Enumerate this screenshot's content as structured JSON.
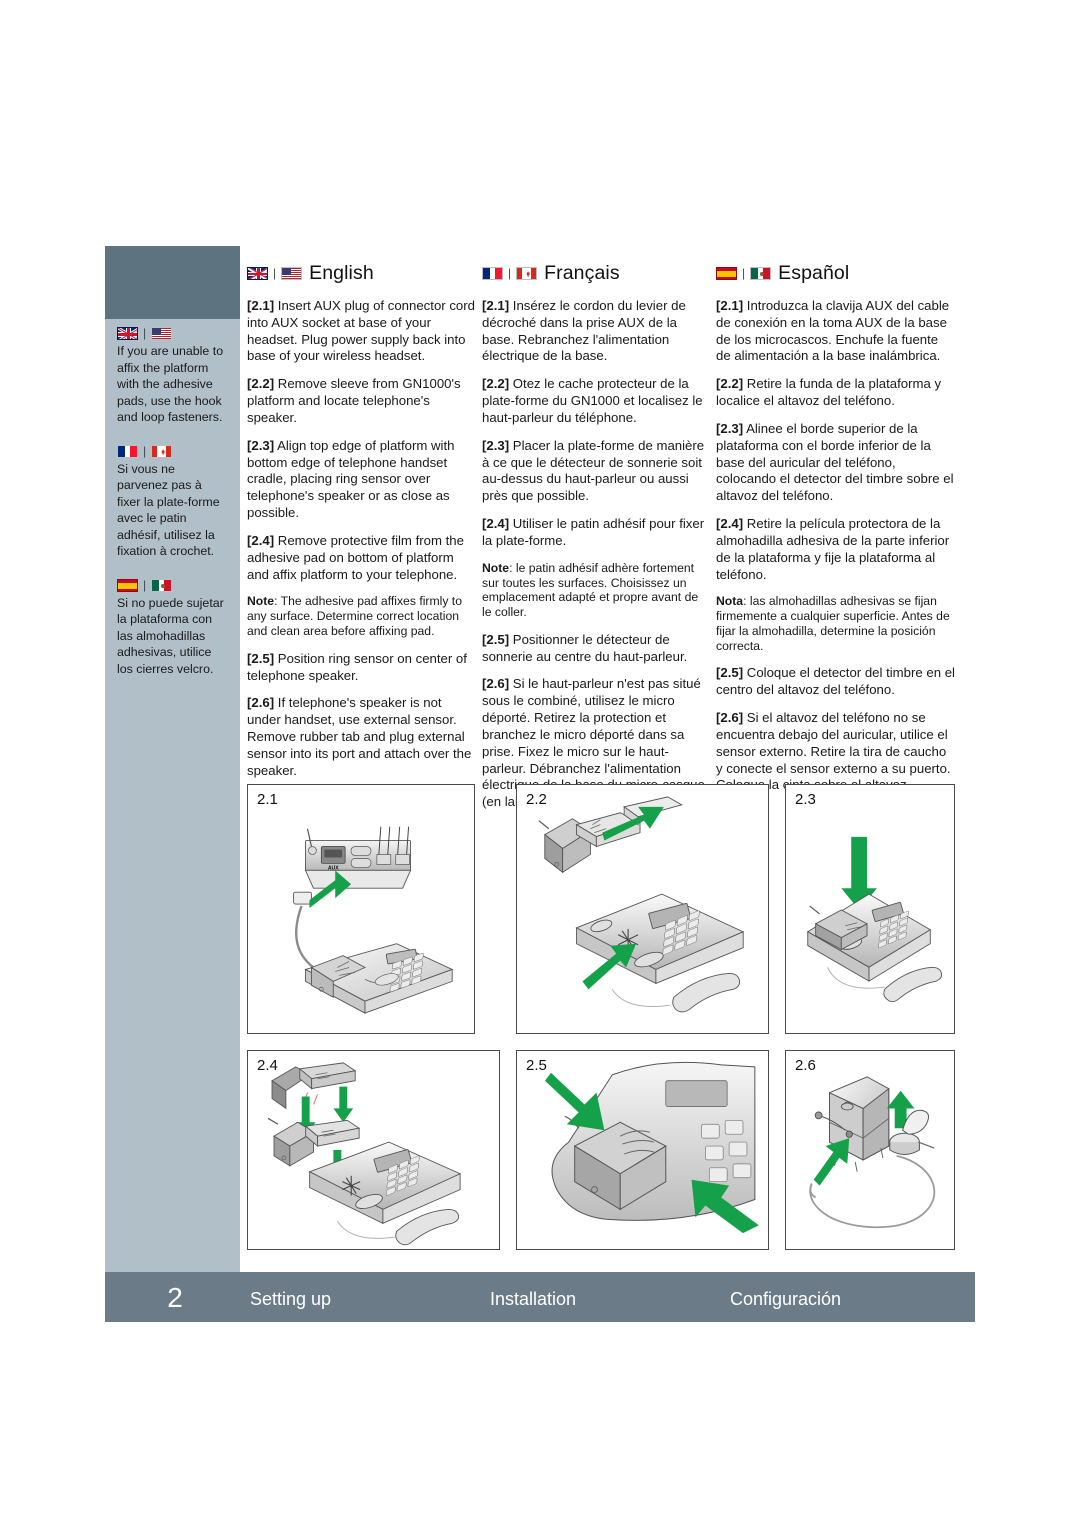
{
  "page": {
    "number": "2",
    "background": "#ffffff"
  },
  "colors": {
    "sidebar_header": "#5d7480",
    "sidebar_body": "#b0bfc8",
    "footer_bar": "#6b7c88",
    "arrow_green": "#15a04a",
    "text": "#1a1a1a"
  },
  "sidebar": {
    "notes": [
      {
        "flags": [
          "uk-flag",
          "us-flag"
        ],
        "text": "If you are unable to affix the platform with the adhesive pads, use the hook and loop fasteners."
      },
      {
        "flags": [
          "france-flag",
          "canada-flag"
        ],
        "text": "Si vous ne parvenez pas à fixer la plate-forme avec le patin adhésif, utilisez la fixation à crochet."
      },
      {
        "flags": [
          "spain-flag",
          "mexico-flag"
        ],
        "text": "Si no puede sujetar la plataforma con las almohadillas adhesivas, utilice los cierres velcro."
      }
    ]
  },
  "columns": {
    "english": {
      "language": "English",
      "flags": [
        "uk-flag",
        "us-flag"
      ],
      "steps": [
        {
          "num": "[2.1]",
          "text": "Insert AUX plug of connector cord into AUX socket at base of your headset. Plug power supply back into base of your wireless headset."
        },
        {
          "num": "[2.2]",
          "text": "Remove sleeve from GN1000's platform and locate telephone's speaker."
        },
        {
          "num": "[2.3]",
          "text": "Align top edge of platform with bottom edge of telephone handset cradle, placing ring sensor over telephone's speaker or as close as possible."
        },
        {
          "num": "[2.4]",
          "text": "Remove protective film from the adhesive pad on bottom of platform and affix platform to your telephone."
        }
      ],
      "note_label": "Note",
      "note_text": ": The adhesive pad affixes firmly to any surface. Determine correct location and clean area before affixing pad.",
      "steps_after": [
        {
          "num": "[2.5]",
          "text": "Position ring sensor on center of telephone speaker."
        },
        {
          "num": "[2.6]",
          "text": "If telephone's speaker is not under handset, use external sensor. Remove rubber tab and plug external sensor into its port and attach over the speaker."
        }
      ]
    },
    "francais": {
      "language": "Français",
      "flags": [
        "france-flag",
        "canada-flag"
      ],
      "steps": [
        {
          "num": "[2.1]",
          "text": "Insérez le cordon du levier de décroché dans la prise AUX de la base. Rebranchez l'alimentation électrique de la base."
        },
        {
          "num": "[2.2]",
          "text": "Otez le cache protecteur de la plate-forme du GN1000 et localisez le haut-parleur du téléphone."
        },
        {
          "num": "[2.3]",
          "text": "Placer la plate-forme de manière à ce que le détecteur de sonnerie soit au-dessus du haut-parleur ou aussi près que possible."
        },
        {
          "num": "[2.4]",
          "text": "Utiliser le patin adhésif pour fixer la plate-forme."
        }
      ],
      "note_label": "Note",
      "note_text": ": le patin adhésif adhère fortement sur toutes les surfaces. Choisissez un emplacement adapté et propre avant de le coller.",
      "steps_after": [
        {
          "num": "[2.5]",
          "text": "Positionner le détecteur de sonnerie au centre du haut-parleur."
        },
        {
          "num": "[2.6]",
          "text": "Si le haut-parleur n'est pas situé sous le combiné, utilisez le micro déporté. Retirez la protection et branchez le micro déporté dans sa prise. Fixez le micro sur le haut-parleur. Débranchez l'alimentation électrique de la base du micro-casque, (en laissant celui-ci dans la base)."
        }
      ]
    },
    "espanol": {
      "language": "Español",
      "flags": [
        "spain-flag",
        "mexico-flag"
      ],
      "steps": [
        {
          "num": "[2.1]",
          "text": "Introduzca la clavija AUX del cable de conexión en la toma AUX de la base de los microcascos. Enchufe la fuente de alimentación a la base inalámbrica."
        },
        {
          "num": "[2.2]",
          "text": "Retire la funda de la plataforma y localice el altavoz del teléfono."
        },
        {
          "num": "[2.3]",
          "text": "Alinee el borde superior de la plataforma con el borde inferior de la base del auricular del teléfono, colocando el detector del timbre sobre el altavoz del teléfono."
        },
        {
          "num": "[2.4]",
          "text": "Retire la película protectora de la almohadilla adhesiva de la parte inferior de la plataforma y fije la plataforma al teléfono."
        }
      ],
      "note_label": "Nota",
      "note_text": ": las almohadillas adhesivas se fijan firmemente a cualquier superficie. Antes de fijar la almohadilla, determine la posición correcta.",
      "steps_after": [
        {
          "num": "[2.5]",
          "text": "Coloque el detector del timbre en el centro del altavoz del teléfono."
        },
        {
          "num": "[2.6]",
          "text": "Si el altavoz del teléfono no se encuentra debajo del auricular, utilice el sensor externo. Retire la tira de caucho y conecte el sensor externo a su puerto. Coloque la cinta sobre el altavoz."
        }
      ]
    }
  },
  "figures": [
    {
      "label": "2.1",
      "caption_key": "aux-plug-into-headset-base"
    },
    {
      "label": "2.2",
      "caption_key": "remove-sleeve-locate-speaker"
    },
    {
      "label": "2.3",
      "caption_key": "align-platform-on-telephone"
    },
    {
      "label": "2.4",
      "caption_key": "remove-film-affix-platform"
    },
    {
      "label": "2.5",
      "caption_key": "position-ring-sensor-closeup"
    },
    {
      "label": "2.6",
      "caption_key": "external-sensor-into-port"
    }
  ],
  "figure_device_labels": {
    "aux_socket": "AUX"
  },
  "footer": {
    "page_number": "2",
    "title_en": "Setting up",
    "title_fr": "Installation",
    "title_es": "Configuración"
  }
}
